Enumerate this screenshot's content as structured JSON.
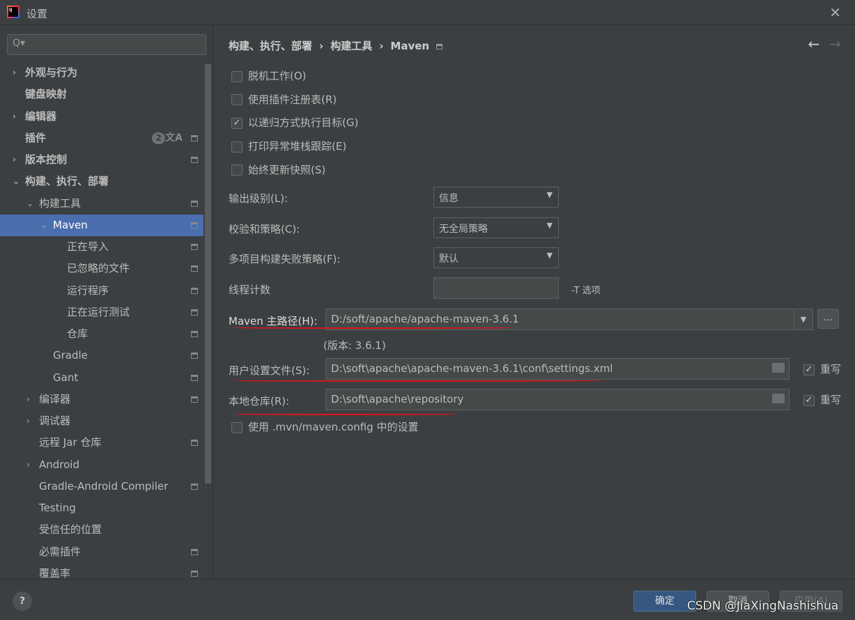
{
  "window": {
    "title": "设置",
    "close": "✕"
  },
  "search": {
    "icon": "Q▾",
    "placeholder": ""
  },
  "sidebar": {
    "items": [
      {
        "label": "外观与行为",
        "chev": "›",
        "level": 0,
        "bold": true
      },
      {
        "label": "键盘映射",
        "level": 0,
        "bold": true
      },
      {
        "label": "编辑器",
        "chev": "›",
        "level": 0,
        "bold": true
      },
      {
        "label": "插件",
        "level": 0,
        "bold": true,
        "badge": "2",
        "translate": "文A",
        "mark": true
      },
      {
        "label": "版本控制",
        "chev": "›",
        "level": 0,
        "bold": true,
        "mark": true
      },
      {
        "label": "构建、执行、部署",
        "chev": "⌄",
        "level": 0,
        "bold": true
      },
      {
        "label": "构建工具",
        "chev": "⌄",
        "level": 1,
        "mark": true
      },
      {
        "label": "Maven",
        "chev": "⌄",
        "level": 2,
        "selected": true,
        "mark": true
      },
      {
        "label": "正在导入",
        "level": 3,
        "mark": true
      },
      {
        "label": "已忽略的文件",
        "level": 3,
        "mark": true
      },
      {
        "label": "运行程序",
        "level": 3,
        "mark": true
      },
      {
        "label": "正在运行测试",
        "level": 3,
        "mark": true
      },
      {
        "label": "仓库",
        "level": 3,
        "mark": true
      },
      {
        "label": "Gradle",
        "level": 2,
        "mark": true
      },
      {
        "label": "Gant",
        "level": 2,
        "mark": true
      },
      {
        "label": "编译器",
        "chev": "›",
        "level": 1,
        "mark": true
      },
      {
        "label": "调试器",
        "chev": "›",
        "level": 1
      },
      {
        "label": "远程 Jar 仓库",
        "level": 1,
        "mark": true
      },
      {
        "label": "Android",
        "chev": "›",
        "level": 1
      },
      {
        "label": "Gradle-Android Compiler",
        "level": 1,
        "mark": true
      },
      {
        "label": "Testing",
        "level": 1
      },
      {
        "label": "受信任的位置",
        "level": 1
      },
      {
        "label": "必需插件",
        "level": 1,
        "mark": true
      },
      {
        "label": "覆盖率",
        "level": 1,
        "mark": true
      }
    ]
  },
  "breadcrumb": [
    "构建、执行、部署",
    "›",
    "构建工具",
    "›",
    "Maven"
  ],
  "nav": {
    "back": "←",
    "forward": "→"
  },
  "checkboxes": [
    {
      "label": "脱机工作(O)",
      "checked": false
    },
    {
      "label": "使用插件注册表(R)",
      "checked": false
    },
    {
      "label": "以递归方式执行目标(G)",
      "checked": true
    },
    {
      "label": "打印异常堆栈跟踪(E)",
      "checked": false
    },
    {
      "label": "始终更新快照(S)",
      "checked": false
    }
  ],
  "selects": [
    {
      "label": "输出级别(L):",
      "value": "信息"
    },
    {
      "label": "校验和策略(C):",
      "value": "无全局策略"
    },
    {
      "label": "多项目构建失败策略(F):",
      "value": "默认"
    }
  ],
  "threads": {
    "label": "线程计数",
    "value": "",
    "hint": "-T 选项"
  },
  "maven_home": {
    "label": "Maven 主路径(H):",
    "value": "D:/soft/apache/apache-maven-3.6.1",
    "browse": "...",
    "version": "(版本: 3.6.1)"
  },
  "user_settings": {
    "label": "用户设置文件(S):",
    "value": "D:\\soft\\apache\\apache-maven-3.6.1\\conf\\settings.xml",
    "override": "重写",
    "checked": true
  },
  "local_repo": {
    "label": "本地仓库(R):",
    "value": "D:\\soft\\apache\\repository",
    "override": "重写",
    "checked": true
  },
  "mvn_config": {
    "label": "使用 .mvn/maven.config 中的设置",
    "checked": false
  },
  "footer": {
    "help": "?",
    "ok": "确定",
    "cancel": "取消",
    "apply": "应用(A)",
    "watermark": "CSDN @JiaXingNashishua"
  }
}
